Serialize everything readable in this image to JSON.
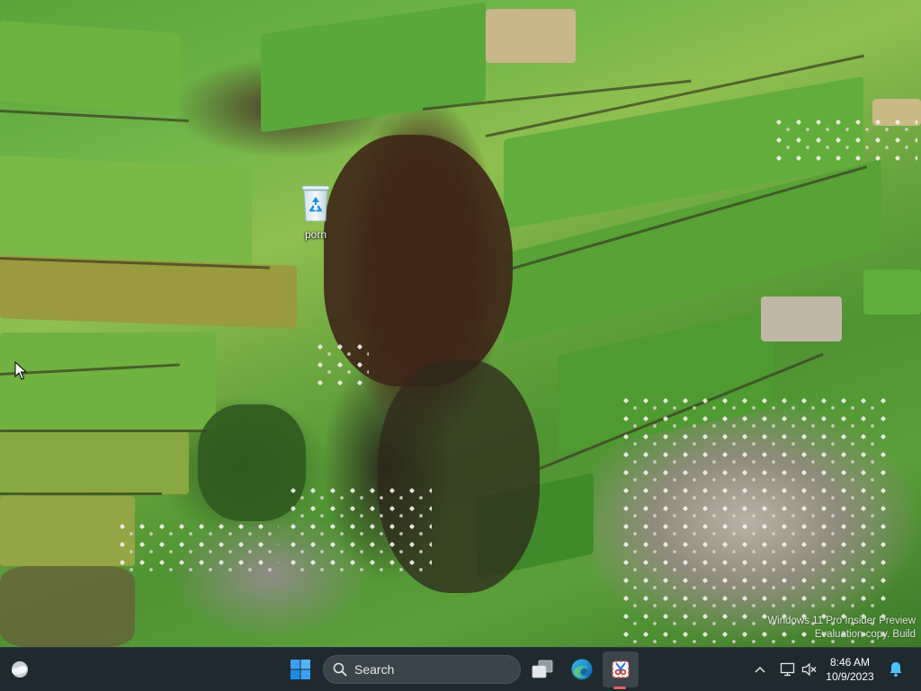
{
  "desktop": {
    "icons": [
      {
        "label": "porn",
        "icon": "recycle-bin-icon"
      }
    ],
    "watermark": {
      "line1": "Windows 11 Pro Insider Preview",
      "line2": "Evaluation copy. Build"
    }
  },
  "taskbar": {
    "search": {
      "label": "Search"
    },
    "apps": [
      {
        "name": "start",
        "icon": "windows-logo-icon"
      },
      {
        "name": "task-view",
        "icon": "task-view-icon"
      },
      {
        "name": "edge",
        "icon": "edge-icon"
      },
      {
        "name": "snipping-tool",
        "icon": "snipping-tool-icon",
        "active": true
      }
    ],
    "tray": {
      "time": "8:46 AM",
      "date": "10/9/2023"
    }
  },
  "colors": {
    "taskbar_bg": "#1f2a30",
    "accent": "#0078d4",
    "active_indicator": "#f25d5d"
  }
}
